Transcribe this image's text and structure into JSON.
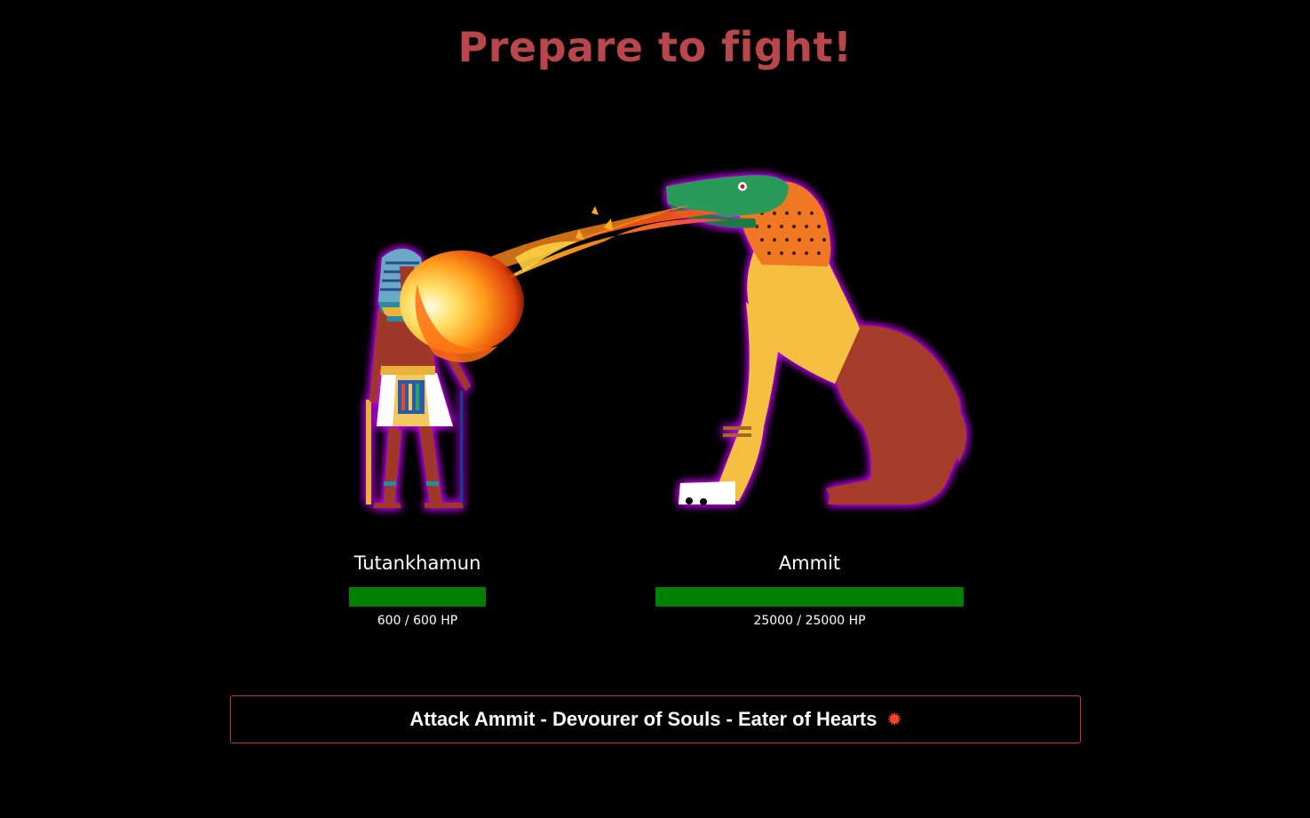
{
  "header": {
    "title": "Prepare to fight!"
  },
  "player": {
    "name": "Tutankhamun",
    "hp_current": 600,
    "hp_max": 600,
    "hp_text": "600 / 600 HP",
    "hp_fraction": 1.0
  },
  "enemy": {
    "name": "Ammit",
    "hp_current": 25000,
    "hp_max": 25000,
    "hp_text": "25000 / 25000 HP",
    "hp_fraction": 1.0
  },
  "actions": {
    "attack_label": "Attack Ammit - Devourer of Souls - Eater of Hearts",
    "attack_icon": "collision-icon"
  },
  "colors": {
    "title": "#b9464b",
    "hp_bar": "#008000",
    "button_border": "#c0393b",
    "glow": "#cc00ff"
  }
}
